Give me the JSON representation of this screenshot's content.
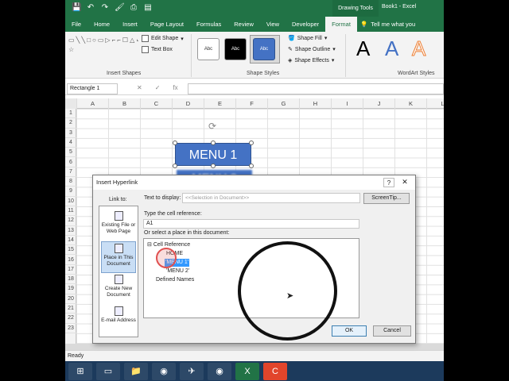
{
  "titlebar": {
    "qat": [
      "💾",
      "↶",
      "↷",
      "🖌",
      "⎙",
      "▤"
    ],
    "context_tab": "Drawing Tools",
    "doc_title": "Book1 - Excel"
  },
  "menubar": {
    "tabs": [
      "File",
      "Home",
      "Insert",
      "Page Layout",
      "Formulas",
      "Review",
      "View",
      "Developer",
      "Format"
    ],
    "active": "Format",
    "tell_me": "Tell me what you"
  },
  "ribbon": {
    "insert_shapes": {
      "label": "Insert Shapes",
      "shapes_preview": "▭╲╲□○▭▷⌐⌐☐△⌙⌐⊿▷⊏⤴∿⌒{}☆",
      "edit_shape": "Edit Shape",
      "text_box": "Text Box"
    },
    "shape_styles": {
      "label": "Shape Styles",
      "swatches": [
        "Abc",
        "Abc",
        "Abc"
      ],
      "fill": "Shape Fill",
      "outline": "Shape Outline",
      "effects": "Shape Effects"
    },
    "wordart": {
      "label": "WordArt Styles",
      "letters": [
        "A",
        "A",
        "A"
      ]
    }
  },
  "formula_bar": {
    "name_box": "Rectangle 1",
    "cancel": "✕",
    "enter": "✓",
    "fx": "fx"
  },
  "sheet": {
    "columns": [
      "A",
      "B",
      "C",
      "D",
      "E",
      "F",
      "G",
      "H",
      "I",
      "J",
      "K",
      "L"
    ],
    "rows": [
      "1",
      "2",
      "3",
      "4",
      "5",
      "6",
      "7",
      "8",
      "9",
      "10",
      "11",
      "12",
      "13",
      "14",
      "15",
      "16",
      "17",
      "18",
      "19",
      "20",
      "21",
      "22",
      "23"
    ],
    "shape1_text": "MENU 1",
    "shape2_text": "MENU 2"
  },
  "status": {
    "ready": "Ready"
  },
  "dialog": {
    "title": "Insert Hyperlink",
    "help": "?",
    "close": "✕",
    "link_to_label": "Link to:",
    "link_to": [
      {
        "label": "Existing File or Web Page"
      },
      {
        "label": "Place in This Document"
      },
      {
        "label": "Create New Document"
      },
      {
        "label": "E-mail Address"
      }
    ],
    "text_to_display_label": "Text to display:",
    "text_to_display_value": "<<Selection in Document>>",
    "screentip": "ScreenTip...",
    "cell_ref_label": "Type the cell reference:",
    "cell_ref_value": "A1",
    "place_label": "Or select a place in this document:",
    "tree": {
      "cell_reference": "Cell Reference",
      "home": "HOME",
      "menu1": "'MENU 1'",
      "menu2": "'MENU 2'",
      "defined_names": "Defined Names"
    },
    "ok": "OK",
    "cancel": "Cancel"
  },
  "taskbar": {
    "items": [
      "⊞",
      "▭",
      "📁",
      "◉",
      "✈",
      "◉",
      "X",
      "C"
    ]
  }
}
